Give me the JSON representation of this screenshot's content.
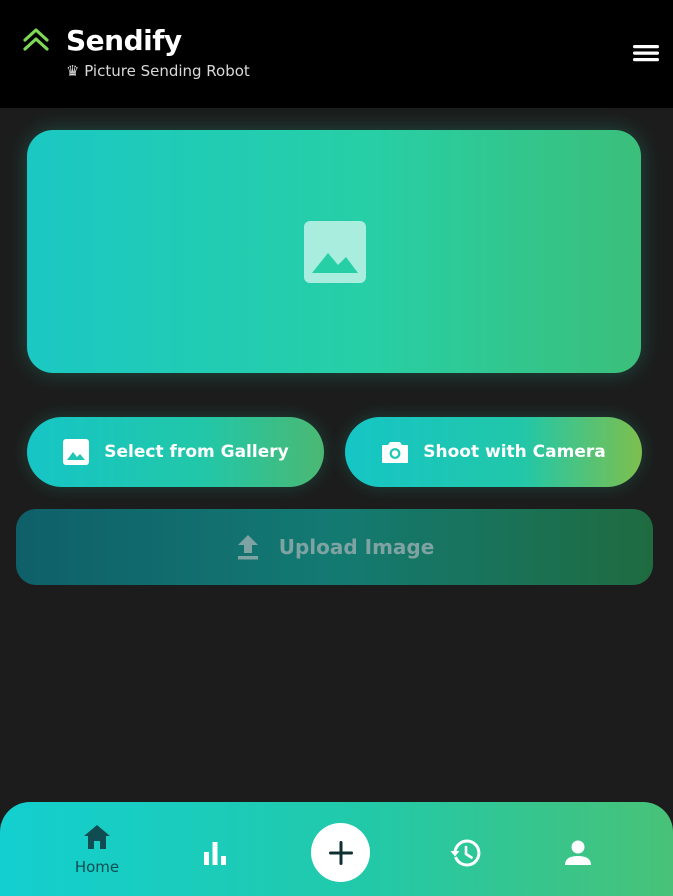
{
  "header": {
    "app_name": "Sendify",
    "subtitle": "♛ Picture Sending Robot",
    "logo_icon": "double-chevron-up-icon",
    "menu_icon": "hamburger-menu-icon"
  },
  "preview": {
    "icon": "image-placeholder-icon"
  },
  "actions": {
    "gallery_label": "Select from Gallery",
    "gallery_icon": "image-icon",
    "camera_label": "Shoot with Camera",
    "camera_icon": "camera-icon",
    "upload_label": "Upload Image",
    "upload_icon": "upload-icon"
  },
  "bottom_nav": {
    "items": [
      {
        "icon": "home-icon",
        "label": "Home"
      },
      {
        "icon": "bar-chart-icon"
      },
      {
        "icon": "plus-icon"
      },
      {
        "icon": "history-icon"
      },
      {
        "icon": "person-icon"
      }
    ]
  },
  "colors": {
    "accent_teal": "#16c6c6",
    "accent_green": "#4bb872",
    "logo_green": "#7ed957",
    "background": "#1c1c1c",
    "header": "#000000"
  }
}
